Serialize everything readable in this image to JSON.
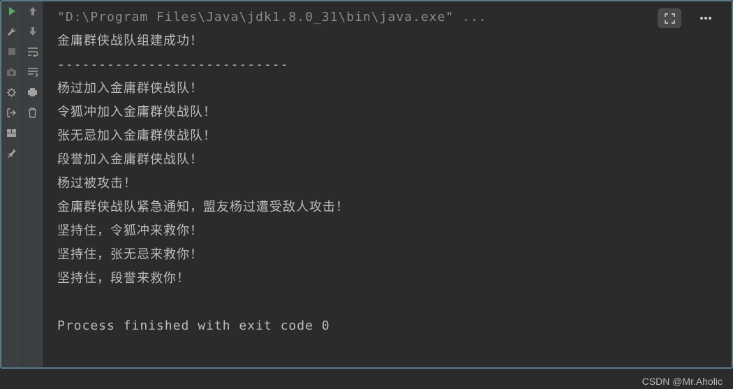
{
  "toolbar_left": {
    "run": "run-icon",
    "wrench": "wrench-icon",
    "stop": "stop-icon",
    "camera": "camera-icon",
    "debug": "debug-icon",
    "exit": "exit-icon",
    "layout": "layout-icon",
    "pin": "pin-icon"
  },
  "toolbar_second": {
    "up": "up-arrow-icon",
    "down": "down-arrow-icon",
    "wrap": "wrap-icon",
    "scroll": "scroll-icon",
    "print": "print-icon",
    "trash": "trash-icon"
  },
  "console": {
    "command": "\"D:\\Program Files\\Java\\jdk1.8.0_31\\bin\\java.exe\" ...",
    "lines": [
      "金庸群侠战队组建成功！",
      "----------------------------",
      "杨过加入金庸群侠战队！",
      "令狐冲加入金庸群侠战队！",
      "张无忌加入金庸群侠战队！",
      "段誉加入金庸群侠战队！",
      "杨过被攻击！",
      "金庸群侠战队紧急通知，盟友杨过遭受敌人攻击！",
      "坚持住，令狐冲来救你！",
      "坚持住，张无忌来救你！",
      "坚持住，段誉来救你！",
      "",
      "Process finished with exit code 0"
    ]
  },
  "top_right": {
    "expand": "expand-icon",
    "more": "more-icon"
  },
  "watermark": "CSDN @Mr.Aholic"
}
